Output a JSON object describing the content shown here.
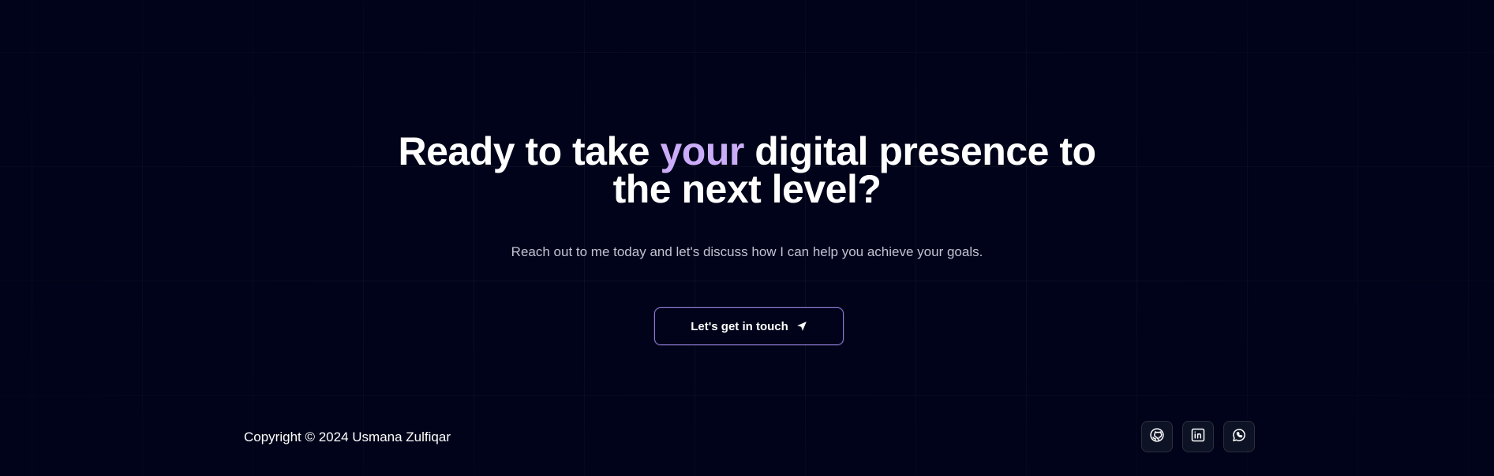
{
  "cta": {
    "headline_before": "Ready to take ",
    "headline_accent": "your",
    "headline_after": " digital presence to the next level?",
    "subtitle": "Reach out to me today and let's discuss how I can help you achieve your goals.",
    "button_label": "Let's get in touch",
    "button_icon": "send-icon"
  },
  "footer": {
    "copyright": "Copyright © 2024 Usmana Zulfiqar",
    "socials": [
      {
        "icon": "github-icon"
      },
      {
        "icon": "linkedin-icon"
      },
      {
        "icon": "whatsapp-icon"
      }
    ]
  },
  "colors": {
    "background": "#000319",
    "accent": "#cbacf9",
    "button_border": "#8a7ad6",
    "subtitle": "#c1c2d3"
  }
}
